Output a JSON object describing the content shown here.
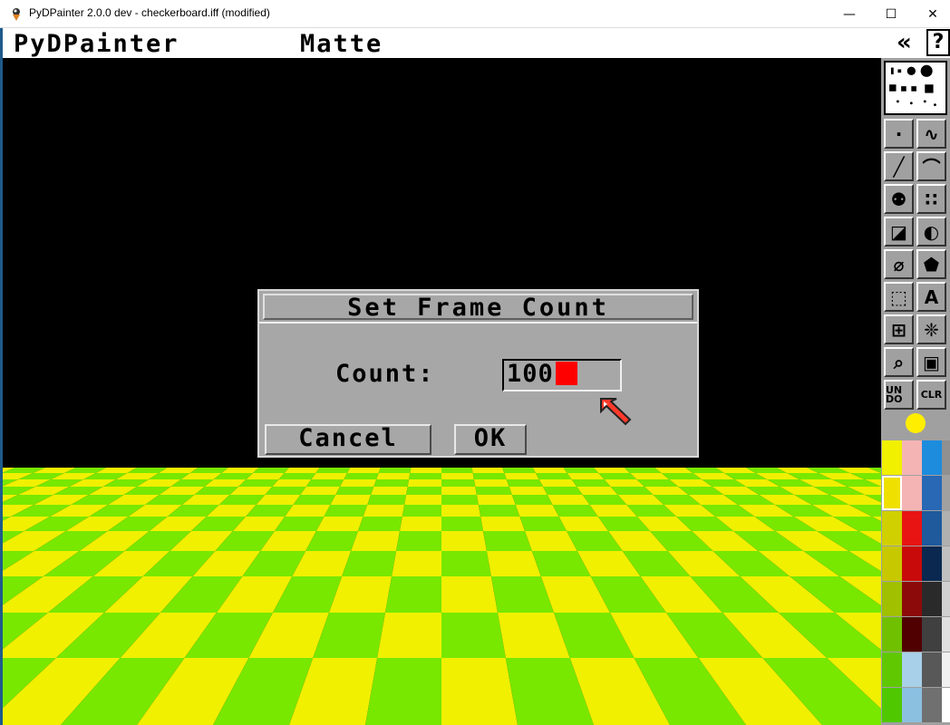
{
  "window": {
    "title": "PyDPainter 2.0.0 dev - checkerboard.iff (modified)",
    "min_glyph": "—",
    "max_glyph": "☐",
    "close_glyph": "✕"
  },
  "menubar": {
    "items": [
      "PyDPainter",
      "Matte"
    ],
    "collapse_glyph": "«",
    "help_label": "?"
  },
  "dialog": {
    "title": "Set Frame Count",
    "count_label": "Count:",
    "count_value": "100",
    "cancel_label": "Cancel",
    "ok_label": "OK"
  },
  "toolbox": {
    "tools": [
      {
        "name": "dot-tool",
        "glyph": "·"
      },
      {
        "name": "freehand-tool",
        "glyph": "∿"
      },
      {
        "name": "line-tool",
        "glyph": "╱"
      },
      {
        "name": "curve-tool",
        "glyph": "⌒"
      },
      {
        "name": "fill-tool",
        "glyph": "⚉"
      },
      {
        "name": "airbrush-tool",
        "glyph": "∷"
      },
      {
        "name": "rectangle-tool",
        "glyph": "◪"
      },
      {
        "name": "circle-tool",
        "glyph": "◐"
      },
      {
        "name": "ellipse-tool",
        "glyph": "⌀"
      },
      {
        "name": "polygon-tool",
        "glyph": "⬟"
      },
      {
        "name": "brush-select-tool",
        "glyph": "⬚"
      },
      {
        "name": "text-tool",
        "glyph": "A"
      },
      {
        "name": "grid-tool",
        "glyph": "⊞"
      },
      {
        "name": "symmetry-tool",
        "glyph": "❈"
      },
      {
        "name": "magnify-tool",
        "glyph": "⌕"
      },
      {
        "name": "zoom-tool",
        "glyph": "▣"
      },
      {
        "name": "undo-tool",
        "glyph": "UN DO"
      },
      {
        "name": "clear-tool",
        "glyph": "CLR"
      }
    ],
    "foreground_color": "#ffee00",
    "palette": [
      [
        "#f0f000",
        "#f4b4b4",
        "#1e8cdc",
        "#909090"
      ],
      [
        "#f0e000",
        "#f4b4b4",
        "#2868b4",
        "#a0a0a0"
      ],
      [
        "#d0d000",
        "#e81414",
        "#1e5a9c",
        "#b0b0b0"
      ],
      [
        "#c8c800",
        "#c80a0a",
        "#0a2850",
        "#c0c0c0"
      ],
      [
        "#a0c000",
        "#8c0a0a",
        "#2a2a2a",
        "#d0d0d0"
      ],
      [
        "#70c000",
        "#500000",
        "#404040",
        "#e0e0e0"
      ],
      [
        "#60c800",
        "#a8d0e8",
        "#585858",
        "#f0f0f0"
      ],
      [
        "#50c800",
        "#8cc0e0",
        "#707070",
        "#ffffff"
      ]
    ]
  },
  "colors": {
    "floor_green": "#78e800",
    "floor_yellow": "#f0f000",
    "dialog_gray": "#a7a7a7",
    "caret_red": "#ff0000"
  }
}
